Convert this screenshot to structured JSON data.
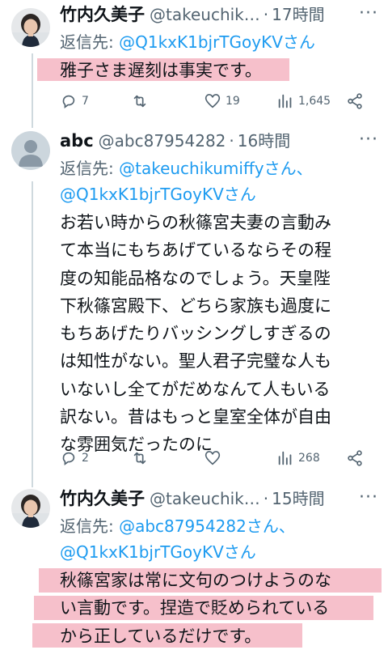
{
  "tweets": [
    {
      "name": "竹内久美子",
      "handle": "@takeuchik…",
      "dot": "·",
      "time": "17時間",
      "more": "···",
      "reply_prefix": "返信先: ",
      "reply_mentions": "@Q1kxK1bjrTGoyKVさん",
      "body_lines": [
        "雅子さま遅刻は事実です。"
      ],
      "highlighted": true,
      "stats": {
        "replies": "7",
        "retweets": "",
        "likes": "19",
        "views": "1,645"
      }
    },
    {
      "name": "abc",
      "handle": "@abc87954282",
      "dot": "·",
      "time": "16時間",
      "more": "···",
      "reply_prefix": "返信先: ",
      "reply_mentions": "@takeuchikumiffyさん、",
      "reply_mentions_2": "@Q1kxK1bjrTGoyKVさん",
      "body_lines": [
        "お若い時からの秋篠宮夫妻の言動み",
        "て本当にもちあげているならその程",
        "度の知能品格なのでしょう。天皇陛",
        "下秋篠宮殿下、どちら家族も過度に",
        "もちあげたりバッシングしすぎるの",
        "は知性がない。聖人君子完璧な人も",
        "いないし全てがだめなんて人もいる",
        "訳ない。昔はもっと皇室全体が自由",
        "な雰囲気だったのに"
      ],
      "highlighted": false,
      "stats": {
        "replies": "2",
        "retweets": "",
        "likes": "",
        "views": "268"
      }
    },
    {
      "name": "竹内久美子",
      "handle": "@takeuchik…",
      "dot": "·",
      "time": "15時間",
      "more": "···",
      "reply_prefix": "返信先: ",
      "reply_mentions": "@abc87954282さん、",
      "reply_mentions_2": "@Q1kxK1bjrTGoyKVさん",
      "body_lines": [
        "秋篠宮家は常に文句のつけようのな",
        "い言動です。捏造で貶められている",
        "から正しているだけです。"
      ],
      "highlighted": true,
      "stats": {
        "replies": "",
        "retweets": "",
        "likes": "",
        "views": ""
      }
    }
  ],
  "colors": {
    "text": "#0f1419",
    "secondary": "#536471",
    "mention": "#1d9bf0",
    "highlight": "#ee8ca0",
    "thread_line": "#cfd9de"
  }
}
